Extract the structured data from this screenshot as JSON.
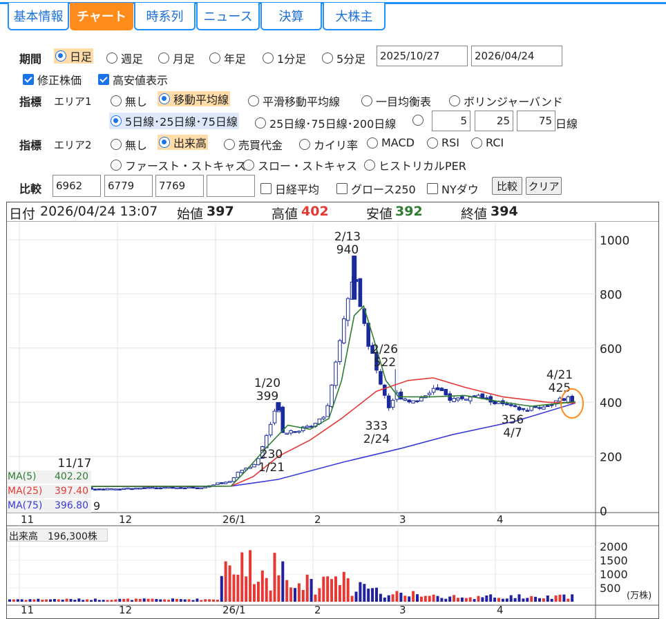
{
  "tabs": [
    {
      "label": "基本情報",
      "active": false
    },
    {
      "label": "チャート",
      "active": true
    },
    {
      "label": "時系列",
      "active": false
    },
    {
      "label": "ニュース",
      "active": false
    },
    {
      "label": "決算",
      "active": false
    },
    {
      "label": "大株主",
      "active": false
    }
  ],
  "period": {
    "label": "期間",
    "options": [
      "日足",
      "週足",
      "月足",
      "年足",
      "1分足",
      "5分足"
    ],
    "selected": "日足",
    "start_date": "2025/10/27",
    "end_date": "2026/04/24"
  },
  "checkboxes": [
    {
      "label": "修正株価",
      "checked": true
    },
    {
      "label": "高安値表示",
      "checked": true
    }
  ],
  "indicator1": {
    "label": "指標",
    "area": "エリア1",
    "options": [
      "無し",
      "移動平均線",
      "平滑移動平均線",
      "一目均衡表",
      "ボリンジャーバンド"
    ],
    "selected": "移動平均線",
    "ma_options": [
      "5日線･25日線･75日線",
      "25日線･75日線･200日線"
    ],
    "ma_selected": "5日線･25日線･75日線",
    "custom": [
      "5",
      "25",
      "75"
    ],
    "custom_suffix": "日線"
  },
  "indicator2": {
    "label": "指標",
    "area": "エリア2",
    "options": [
      "無し",
      "出来高",
      "売買代金",
      "カイリ率",
      "MACD",
      "RSI",
      "RCI",
      "ファースト・ストキャス",
      "スロー・ストキャス",
      "ヒストリカルPER"
    ],
    "selected": "出来高"
  },
  "compare": {
    "label": "比較",
    "codes": [
      "6962",
      "6779",
      "7769",
      ""
    ],
    "index_options": [
      "日経平均",
      "グロース250",
      "NYダウ"
    ],
    "compare_button": "比較",
    "clear_button": "クリア"
  },
  "info": {
    "date_label": "日付",
    "datetime": "2026/04/24 13:07",
    "open_label": "始値",
    "open": "397",
    "high_label": "高値",
    "high": "402",
    "low_label": "安値",
    "low": "392",
    "close_label": "終値",
    "close": "394"
  },
  "ma_legend": [
    {
      "name": "MA(5)",
      "value": "402.20",
      "color": "#2e7d32"
    },
    {
      "name": "MA(25)",
      "value": "397.40",
      "color": "#e53935"
    },
    {
      "name": "MA(75)",
      "value": "396.80",
      "color": "#3a3ad8"
    }
  ],
  "volume_label": "出来高　196,300株",
  "annotations": [
    {
      "lines": [
        "11/17"
      ],
      "anchor": "left-low"
    },
    {
      "lines": [
        "1/20",
        "399"
      ]
    },
    {
      "lines": [
        "230",
        "1/21"
      ]
    },
    {
      "lines": [
        "2/13",
        "940"
      ]
    },
    {
      "lines": [
        "2/26",
        "522"
      ]
    },
    {
      "lines": [
        "333",
        "2/24"
      ]
    },
    {
      "lines": [
        "356",
        "4/7"
      ]
    },
    {
      "lines": [
        "4/21",
        "425"
      ]
    }
  ],
  "partial_low_label": "9",
  "volume_unit": "(万株)",
  "colors": {
    "accent": "#1e90ff",
    "active_tab": "#ff8c1a",
    "up": "#ffffff",
    "down": "#1a2a9c",
    "vol_up": "#e53935",
    "vol_down": "#2020a0",
    "highlight": "#ff8c1a"
  },
  "chart_data": {
    "type": "candlestick",
    "price_axis": {
      "ticks": [
        0,
        200,
        400,
        600,
        800,
        1000
      ],
      "ylim": [
        0,
        1000
      ]
    },
    "volume_axis": {
      "ticks": [
        500,
        1000,
        1500,
        2000
      ],
      "unit": "(万株)"
    },
    "x_ticks": [
      "11",
      "12",
      "26/1",
      "2",
      "3",
      "4"
    ],
    "series_price_path": [
      [
        "2025-10-27",
        88
      ],
      [
        "2025-11-17",
        80
      ],
      [
        "2025-12-26",
        85
      ],
      [
        "2026-01-05",
        110
      ],
      [
        "2026-01-08",
        150
      ],
      [
        "2026-01-13",
        170
      ],
      [
        "2026-01-16",
        270
      ],
      [
        "2026-01-20",
        399
      ],
      [
        "2026-01-21",
        290
      ],
      [
        "2026-01-27",
        300
      ],
      [
        "2026-01-30",
        310
      ],
      [
        "2026-02-04",
        360
      ],
      [
        "2026-02-06",
        460
      ],
      [
        "2026-02-10",
        730
      ],
      [
        "2026-02-13",
        870
      ],
      [
        "2026-02-17",
        640
      ],
      [
        "2026-02-20",
        520
      ],
      [
        "2026-02-24",
        380
      ],
      [
        "2026-02-26",
        430
      ],
      [
        "2026-03-04",
        400
      ],
      [
        "2026-03-10",
        450
      ],
      [
        "2026-03-16",
        410
      ],
      [
        "2026-03-24",
        420
      ],
      [
        "2026-03-31",
        395
      ],
      [
        "2026-04-07",
        370
      ],
      [
        "2026-04-14",
        385
      ],
      [
        "2026-04-21",
        415
      ],
      [
        "2026-04-24",
        395
      ]
    ],
    "ma5": [
      [
        "2025-10-27",
        88
      ],
      [
        "2026-01-05",
        90
      ],
      [
        "2026-01-10",
        150
      ],
      [
        "2026-01-16",
        230
      ],
      [
        "2026-01-23",
        315
      ],
      [
        "2026-01-30",
        300
      ],
      [
        "2026-02-05",
        340
      ],
      [
        "2026-02-09",
        480
      ],
      [
        "2026-02-13",
        720
      ],
      [
        "2026-02-16",
        755
      ],
      [
        "2026-02-19",
        640
      ],
      [
        "2026-02-23",
        480
      ],
      [
        "2026-02-27",
        420
      ],
      [
        "2026-03-10",
        420
      ],
      [
        "2026-03-20",
        425
      ],
      [
        "2026-04-01",
        400
      ],
      [
        "2026-04-10",
        385
      ],
      [
        "2026-04-24",
        402
      ]
    ],
    "ma25": [
      [
        "2025-10-27",
        88
      ],
      [
        "2026-01-05",
        90
      ],
      [
        "2026-01-12",
        125
      ],
      [
        "2026-01-20",
        200
      ],
      [
        "2026-01-30",
        260
      ],
      [
        "2026-02-09",
        340
      ],
      [
        "2026-02-20",
        440
      ],
      [
        "2026-03-02",
        480
      ],
      [
        "2026-03-10",
        490
      ],
      [
        "2026-03-20",
        455
      ],
      [
        "2026-04-01",
        420
      ],
      [
        "2026-04-15",
        400
      ],
      [
        "2026-04-24",
        397
      ]
    ],
    "ma75": [
      [
        "2025-10-27",
        88
      ],
      [
        "2026-01-05",
        90
      ],
      [
        "2026-01-20",
        115
      ],
      [
        "2026-02-10",
        180
      ],
      [
        "2026-02-28",
        230
      ],
      [
        "2026-03-16",
        280
      ],
      [
        "2026-04-05",
        330
      ],
      [
        "2026-04-24",
        397
      ]
    ]
  }
}
